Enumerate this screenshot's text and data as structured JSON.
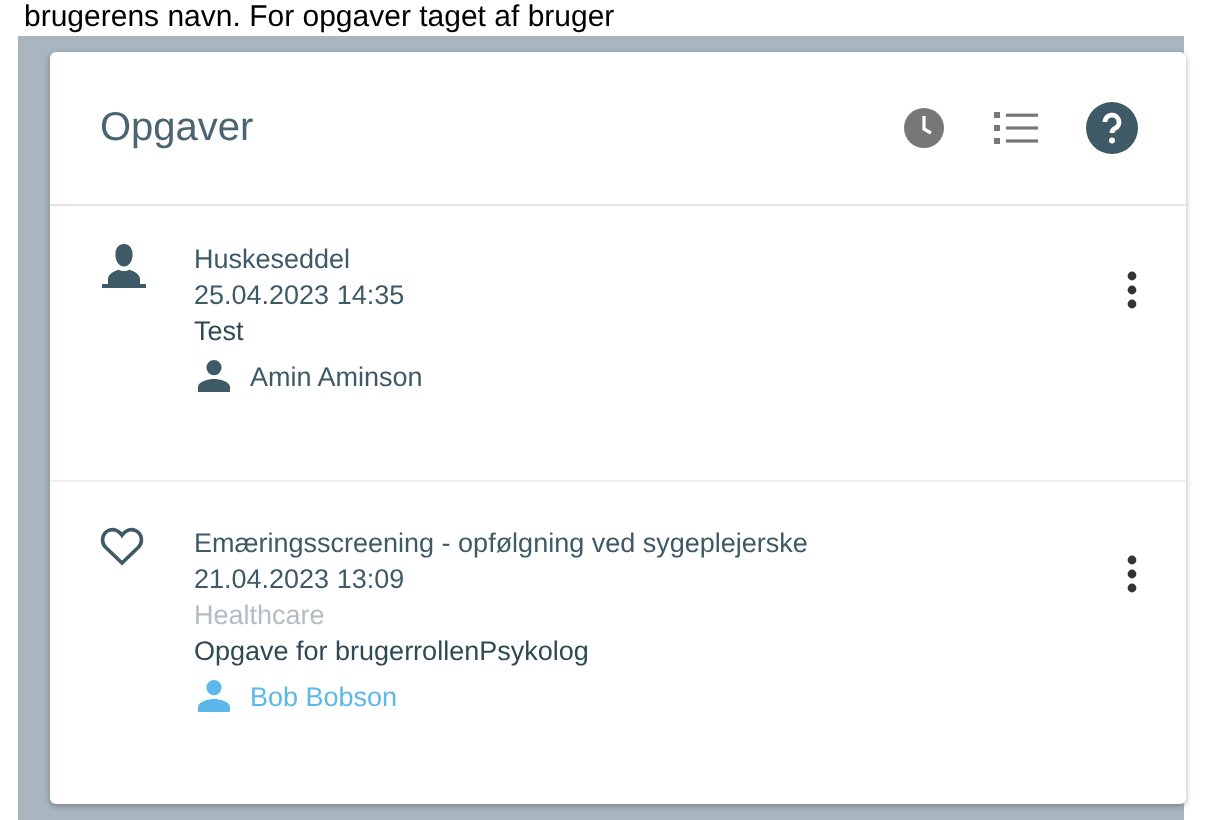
{
  "caption": "brugerens navn. For opgaver taget af bruger",
  "panel": {
    "title": "Opgaver"
  },
  "tasks": [
    {
      "kind": "person",
      "title": "Huskeseddel",
      "date": "25.04.2023 14:35",
      "description": "Test",
      "assignee": {
        "name": "Amin Aminson",
        "color": "#3d5a66"
      }
    },
    {
      "kind": "heart",
      "title": "Emæringsscreening - opfølgning ved sygeplejerske",
      "date": "21.04.2023 13:09",
      "category": "Healthcare",
      "description": "Opgave for brugerrollenPsykolog",
      "assignee": {
        "name": "Bob Bobson",
        "color": "#5bb8e8"
      }
    }
  ]
}
